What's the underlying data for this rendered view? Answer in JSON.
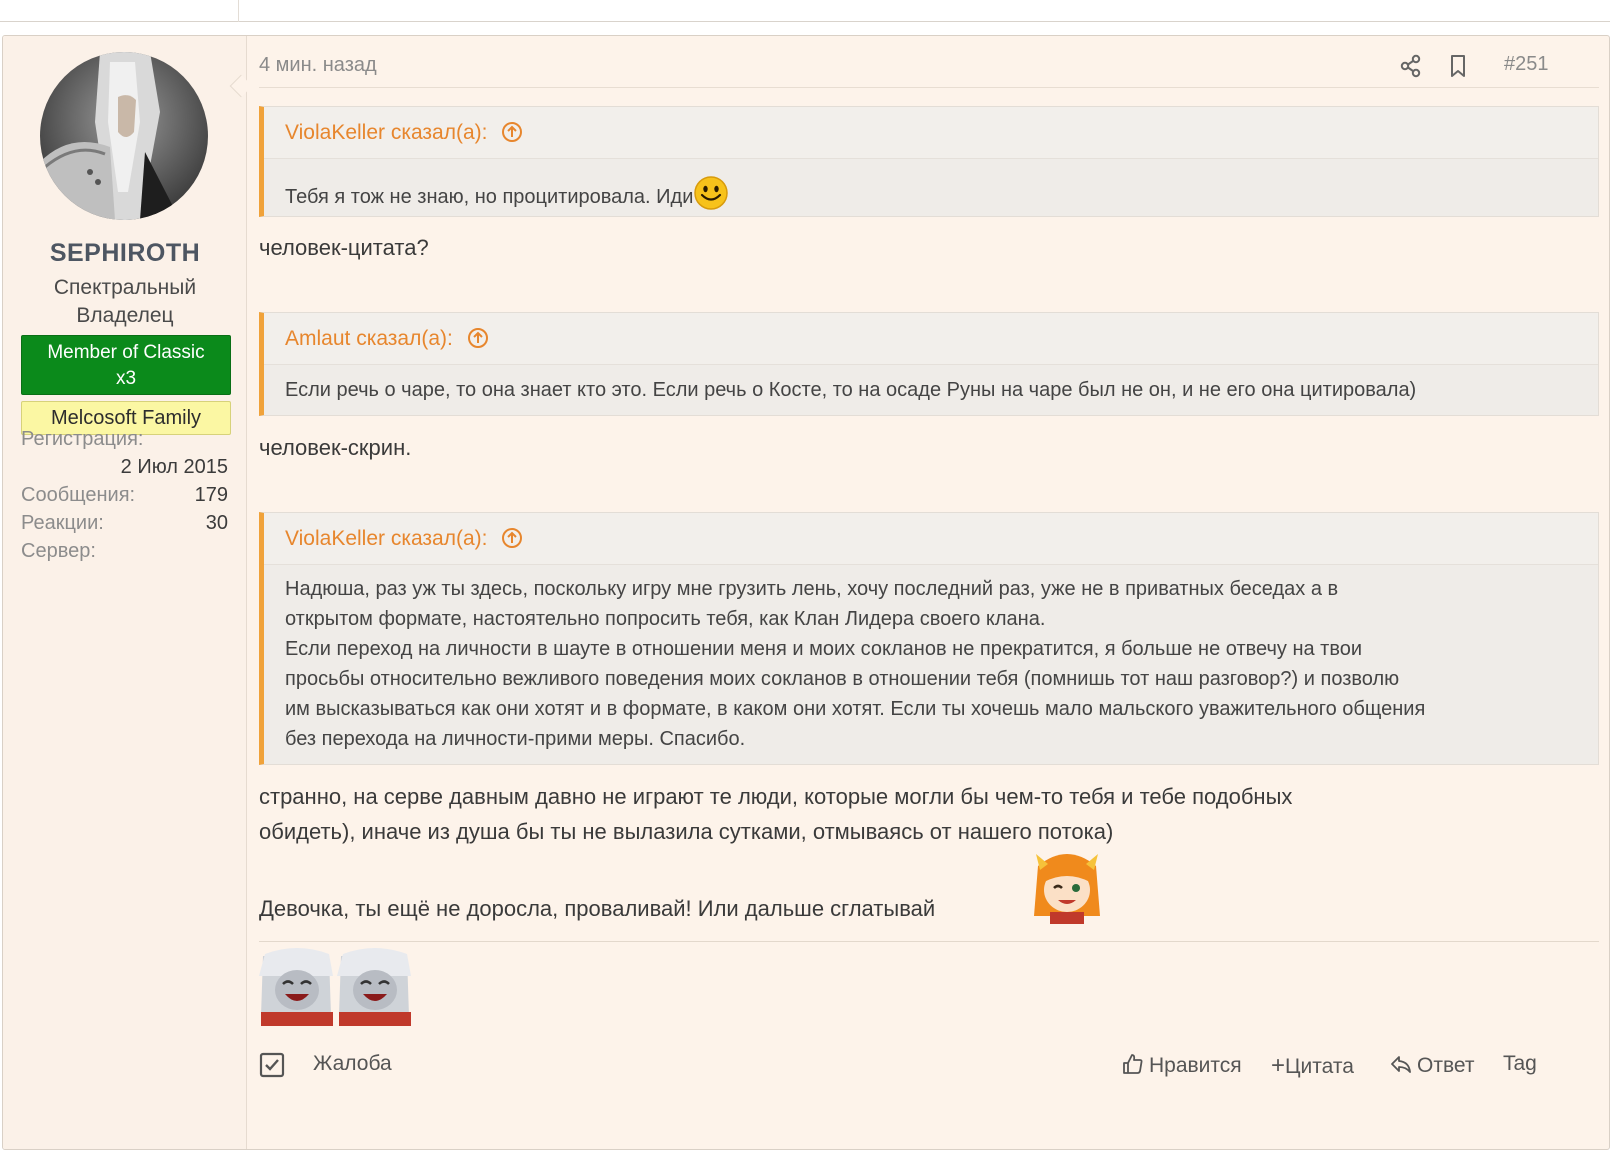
{
  "post": {
    "time": "4 мин. назад",
    "number": "#251"
  },
  "user": {
    "name": "SEPHIROTH",
    "title_line1": "Спектральный",
    "title_line2": "Владелец",
    "banner_green_line1": "Member of Classic",
    "banner_green_line2": "x3",
    "banner_yellow": "Melcosoft Family",
    "stats": [
      {
        "label": "Регистрация:",
        "value": "2 Июл 2015"
      },
      {
        "label": "Сообщения:",
        "value": "179"
      },
      {
        "label": "Реакции:",
        "value": "30"
      },
      {
        "label": "Сервер:",
        "value": ""
      }
    ]
  },
  "quotes": [
    {
      "author": "ViolaKeller сказал(а):",
      "text": "Тебя я тож не знаю, но процитировала. Иди"
    },
    {
      "author": "Amlaut сказал(а):",
      "text": "Если речь о чаре, то она знает кто это. Если речь о Косте, то на осаде Руны на чаре был не он, и не его она цитировала)"
    },
    {
      "author": "ViolaKeller сказал(а):",
      "lines": [
        "Надюша, раз уж ты здесь, поскольку игру мне грузить лень, хочу последний раз, уже не в приватных беседах а в",
        "открытом формате, настоятельно попросить тебя, как Клан Лидера своего клана.",
        "Если переход на личности в шауте в отношении меня и моих сокланов не прекратится, я больше не отвечу на твои",
        "просьбы относительно вежливого поведения моих сокланов в отношении тебя (помнишь тот наш разговор?) и позволю",
        "им высказываться как они хотят и в формате, в каком они хотят. Если ты хочешь мало мальского уважительного общения",
        "без перехода на личности-прими меры. Спасибо."
      ]
    }
  ],
  "replies": {
    "reply1": "человек-цитата?",
    "reply2": "человек-скрин.",
    "reply3_line1": "странно, на серве давным давно не играют те люди, которые могли бы чем-то тебя и тебе подобных",
    "reply3_line2": "обидеть), иначе из душа бы ты не вылазила сутками, отмываясь от нашего потока)",
    "reply4": "Девочка, ты ещё не доросла, проваливай! Или дальше сглатывай"
  },
  "actions": {
    "report": "Жалоба",
    "like": "Нравится",
    "quote": "Цитата",
    "reply": "Ответ",
    "tag": "Tag"
  },
  "colors": {
    "quote_accent": "#f0a23a",
    "quote_author": "#e7862d",
    "banner_green": "#0b8a1b",
    "banner_yellow": "#fbf7a3",
    "post_bg": "#fdf3ea"
  }
}
